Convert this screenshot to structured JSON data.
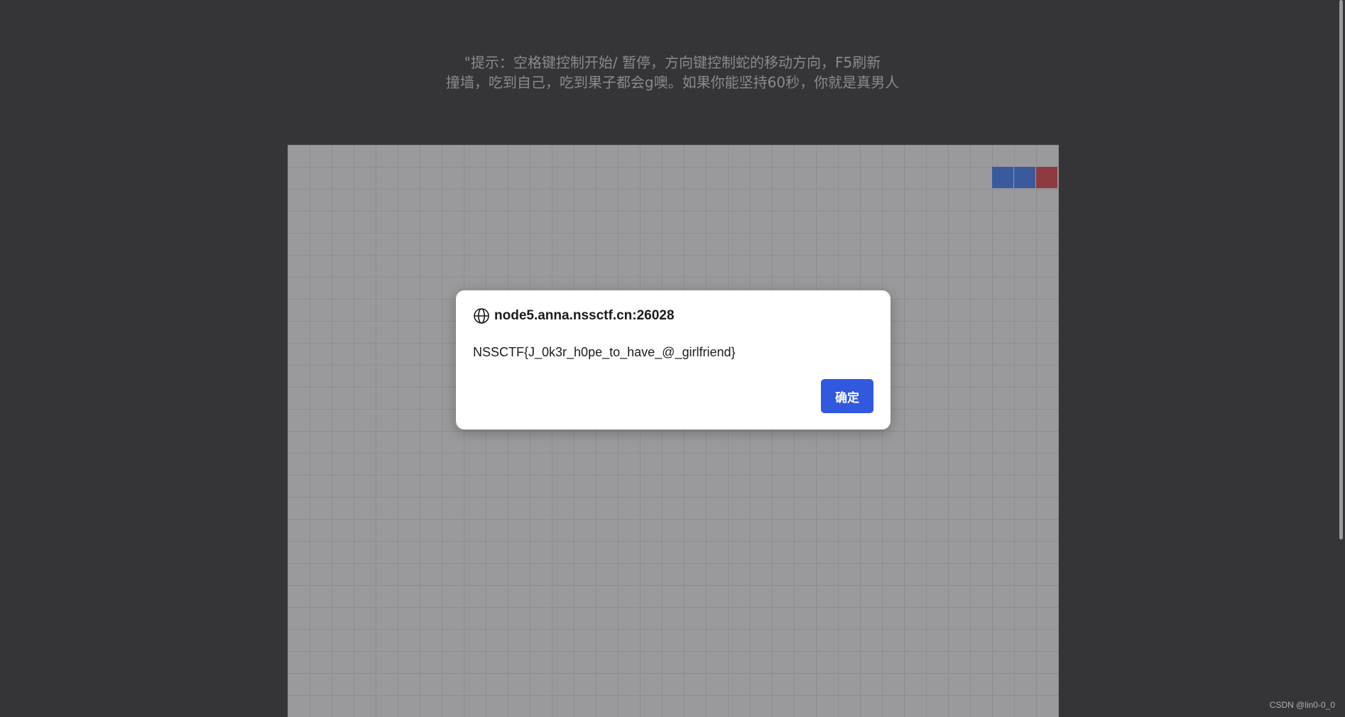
{
  "hint": {
    "line1": "\"提示：空格键控制开始/ 暂停，方向键控制蛇的移动方向，F5刷新",
    "line2": "撞墙，吃到自己，吃到果子都会g噢。如果你能坚持60秒，你就是真男人"
  },
  "dialog": {
    "origin": "node5.anna.nssctf.cn:26028",
    "message": "NSSCTF{J_0k3r_h0pe_to_have_@_girlfriend}",
    "ok_label": "确定",
    "icon": "globe-icon"
  },
  "watermark": "CSDN @lin0-0_0",
  "colors": {
    "snake_body": "#3b5a9d",
    "snake_head": "#8f3a40",
    "button": "#3159e0"
  }
}
